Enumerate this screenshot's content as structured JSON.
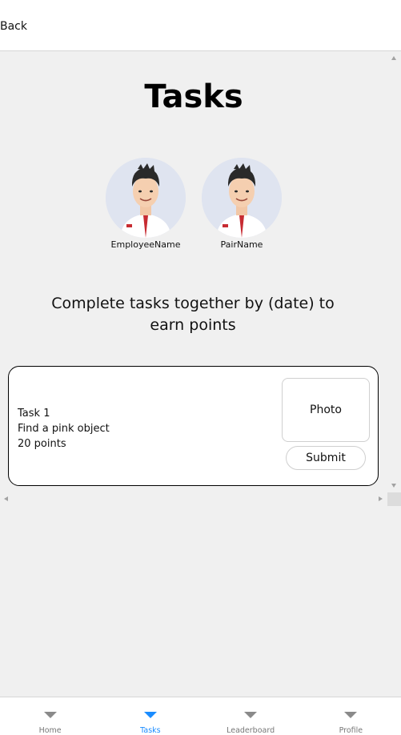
{
  "header": {
    "back_label": "Back"
  },
  "page": {
    "title": "Tasks",
    "prompt": "Complete tasks together by (date) to earn points"
  },
  "avatars": [
    {
      "name": "EmployeeName",
      "icon": "employee-avatar-icon"
    },
    {
      "name": "PairName",
      "icon": "pair-avatar-icon"
    }
  ],
  "task": {
    "title": "Task 1",
    "description": "Find a pink object",
    "points": "20 points",
    "photo_label": "Photo",
    "submit_label": "Submit"
  },
  "tabs": [
    {
      "label": "Home",
      "active": false
    },
    {
      "label": "Tasks",
      "active": true
    },
    {
      "label": "Leaderboard",
      "active": false
    },
    {
      "label": "Profile",
      "active": false
    }
  ],
  "colors": {
    "accent": "#1a8cff",
    "content_bg": "#f0f0f0",
    "avatar_bg": "#dfe4f0"
  }
}
